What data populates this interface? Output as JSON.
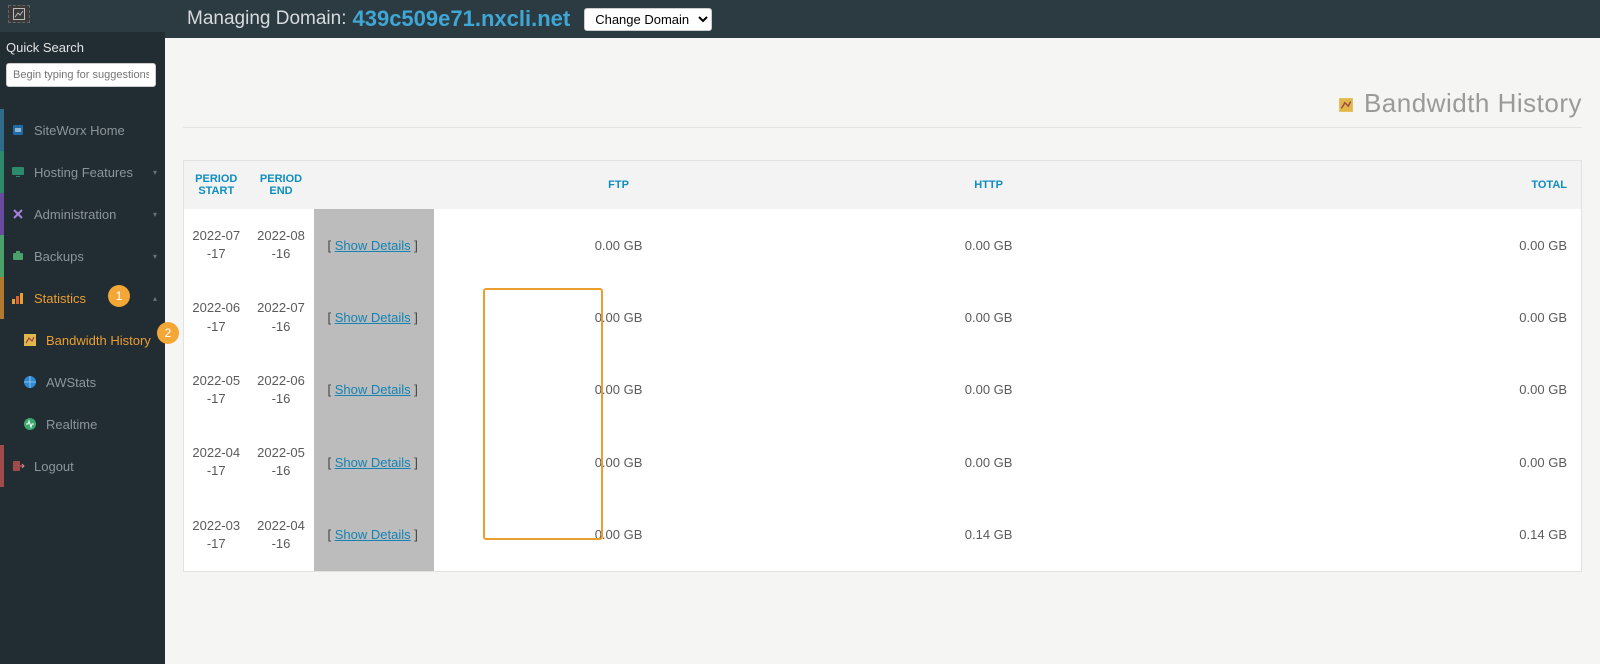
{
  "sidebar": {
    "quick_search_label": "Quick Search",
    "quick_search_placeholder": "Begin typing for suggestions",
    "items": [
      {
        "label": "SiteWorx Home",
        "icon_bg": "#1f6aa9"
      },
      {
        "label": "Hosting Features",
        "icon_bg": "#2c8a6b"
      },
      {
        "label": "Administration",
        "icon_bg": "#6a4aa1"
      },
      {
        "label": "Backups",
        "icon_bg": "#4aa16a"
      },
      {
        "label": "Statistics",
        "icon_bg": "#b37a2f"
      },
      {
        "label": "Logout",
        "icon_bg": "#a14a4a"
      }
    ],
    "stats_children": [
      {
        "label": "Bandwidth History"
      },
      {
        "label": "AWStats"
      },
      {
        "label": "Realtime"
      }
    ],
    "badges": {
      "one": "1",
      "two": "2"
    }
  },
  "header": {
    "label": "Managing Domain:",
    "domain": "439c509e71.nxcli.net",
    "select_label": "Change Domain"
  },
  "page": {
    "title": "Bandwidth History"
  },
  "table": {
    "headers": {
      "period_start": "PERIOD START",
      "period_end": "PERIOD END",
      "details": "",
      "ftp": "FTP",
      "http": "HTTP",
      "total": "TOTAL"
    },
    "show_details_text": "Show Details",
    "rows": [
      {
        "start": "2022-07-17",
        "end": "2022-08-16",
        "ftp": "0.00 GB",
        "http": "0.00 GB",
        "total": "0.00 GB"
      },
      {
        "start": "2022-06-17",
        "end": "2022-07-16",
        "ftp": "0.00 GB",
        "http": "0.00 GB",
        "total": "0.00 GB"
      },
      {
        "start": "2022-05-17",
        "end": "2022-06-16",
        "ftp": "0.00 GB",
        "http": "0.00 GB",
        "total": "0.00 GB"
      },
      {
        "start": "2022-04-17",
        "end": "2022-05-16",
        "ftp": "0.00 GB",
        "http": "0.00 GB",
        "total": "0.00 GB"
      },
      {
        "start": "2022-03-17",
        "end": "2022-04-16",
        "ftp": "0.00 GB",
        "http": "0.14 GB",
        "total": "0.14 GB"
      }
    ]
  }
}
